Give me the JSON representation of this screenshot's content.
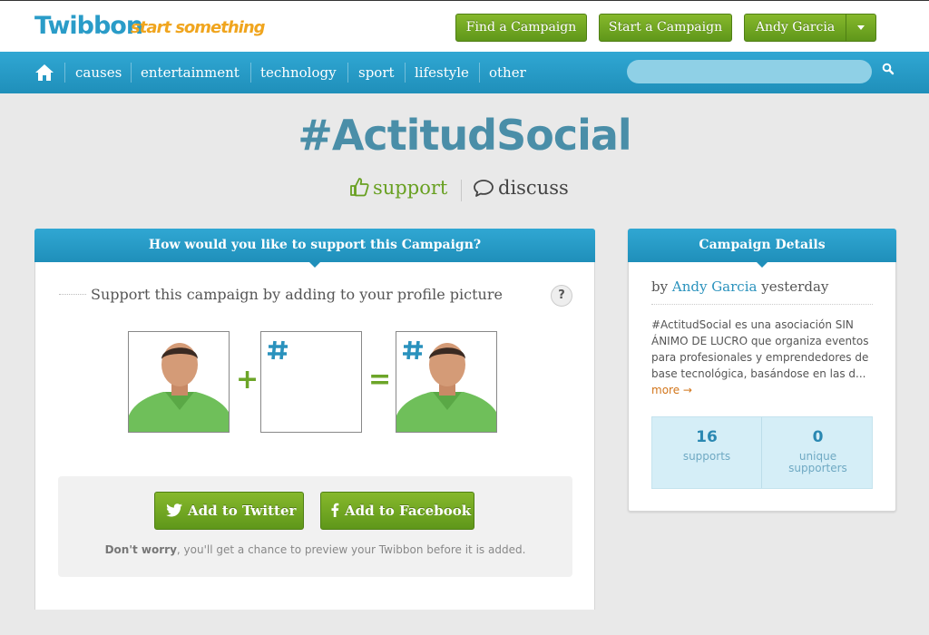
{
  "header": {
    "logo": "Twibbon",
    "tagline": "start something",
    "find_campaign": "Find a Campaign",
    "start_campaign": "Start a Campaign",
    "user_name": "Andy Garcia"
  },
  "nav": {
    "items": [
      {
        "label": "causes"
      },
      {
        "label": "entertainment"
      },
      {
        "label": "technology"
      },
      {
        "label": "sport"
      },
      {
        "label": "lifestyle"
      },
      {
        "label": "other"
      }
    ],
    "search_placeholder": ""
  },
  "campaign": {
    "title": "#ActitudSocial",
    "support_label": "support",
    "discuss_label": "discuss"
  },
  "support_panel": {
    "heading": "How would you like to support this Campaign?",
    "instruction": "Support this campaign by adding to your profile picture",
    "help": "?",
    "add_twitter": "Add to Twitter",
    "add_facebook": "Add to Facebook",
    "note_bold": "Don't worry",
    "note_rest": ", you'll get a chance to preview your Twibbon before it is added."
  },
  "details_panel": {
    "heading": "Campaign Details",
    "by": "by",
    "author": "Andy Garcia",
    "when": "yesterday",
    "description": "#ActitudSocial es una asociación SIN ÁNIMO DE LUCRO que organiza eventos para profesionales y emprendedores de base tecnológica, basándose en las d...",
    "more": "more →",
    "stats": [
      {
        "value": "16",
        "label": "supports"
      },
      {
        "value": "0",
        "label": "unique supporters"
      }
    ]
  },
  "colors": {
    "brand_blue": "#2a9cc8",
    "brand_green": "#6ca528",
    "tag_orange": "#f0a51e",
    "title_blue": "#4a8ea8"
  }
}
